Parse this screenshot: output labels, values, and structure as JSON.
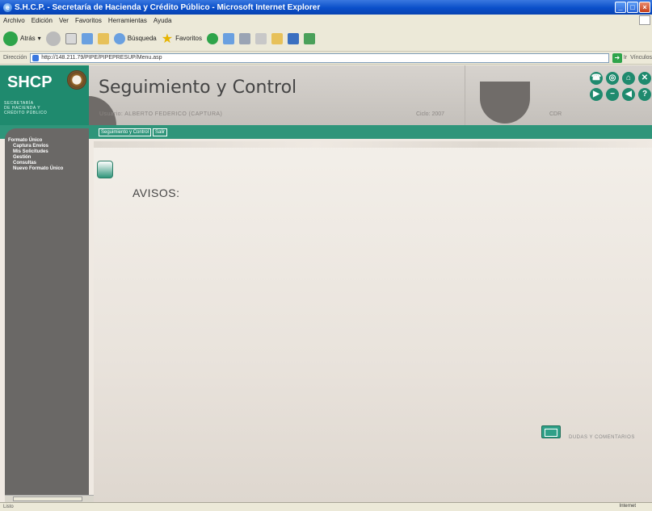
{
  "window": {
    "title": "S.H.C.P. - Secretaría de Hacienda y Crédito Público - Microsoft Internet Explorer"
  },
  "menu": [
    "Archivo",
    "Edición",
    "Ver",
    "Favoritos",
    "Herramientas",
    "Ayuda"
  ],
  "toolbar": {
    "back": "Atrás",
    "search": "Búsqueda",
    "favorites": "Favoritos"
  },
  "address": {
    "label": "Dirección",
    "url": "http://148.211.79/PIPE/PIPEPRESUP/Menu.asp",
    "go": "Ir",
    "links": "Vínculos"
  },
  "header": {
    "logo": "SHCP",
    "department": [
      "SECRETARÍA",
      "DE HACIENDA Y",
      "CRÉDITO PÚBLICO"
    ],
    "app_title": "Seguimiento y Control",
    "usuario": "Usuario: ALBERTO FEDERICO (CAPTURA)",
    "ciclo": "Ciclo: 2007",
    "cdr": "CDR"
  },
  "tabs": [
    "Seguimiento y Control",
    "Salir"
  ],
  "sidebar": {
    "group": "Formato Único",
    "items": [
      "Captura Envíos",
      "Mis Solicitudes",
      "Gestión",
      "Consultas",
      "Nuevo Formato Único"
    ]
  },
  "content": {
    "avisos": "AVISOS:",
    "dudas": "DUDAS Y COMENTARIOS"
  },
  "status": {
    "left": "Listo",
    "zone": "Internet"
  }
}
